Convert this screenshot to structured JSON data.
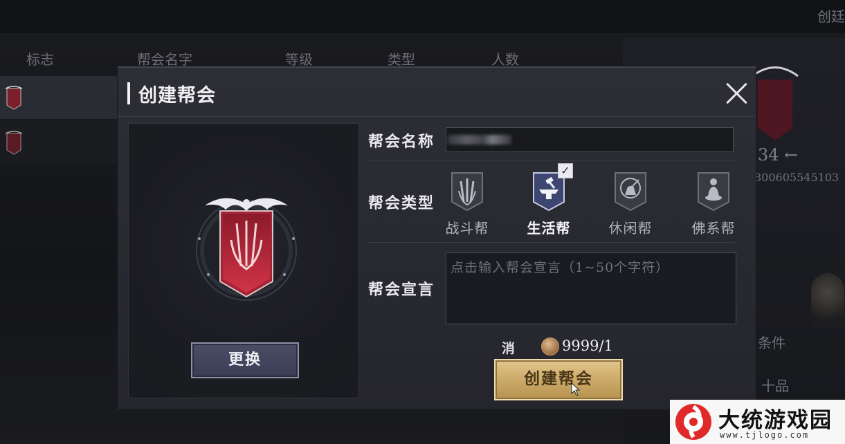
{
  "background": {
    "create_tab": "创廷",
    "table_headers": [
      "标志",
      "帮会名字",
      "等级",
      "类型",
      "人数"
    ],
    "right_panel": {
      "member_count": "34 ←",
      "guild_id": "800605545103",
      "condition_label": "条件",
      "level_label": "十品"
    }
  },
  "dialog": {
    "title": "创建帮会",
    "change_button": "更换",
    "name_label": "帮会名称",
    "name_value": "",
    "type_label": "帮会类型",
    "types": [
      {
        "label": "战斗帮",
        "selected": false,
        "icon": "swords-icon"
      },
      {
        "label": "生活帮",
        "selected": true,
        "icon": "anvil-icon"
      },
      {
        "label": "休闲帮",
        "selected": false,
        "icon": "fishing-icon"
      },
      {
        "label": "佛系帮",
        "selected": false,
        "icon": "meditation-icon"
      }
    ],
    "check_mark": "✓",
    "declaration_label": "帮会宣言",
    "declaration_placeholder": "点击输入帮会宣言（1~50个字符）",
    "cost_label": "消耗:",
    "cost_value": "9999/1",
    "create_button": "创建帮会"
  },
  "watermark": {
    "title": "大统游戏园",
    "url": "www.tjlogo.com"
  },
  "colors": {
    "dialog_bg": "#2b2c33",
    "gold_button": "#caa866",
    "change_button": "#454760",
    "banner_red": "#b4283a"
  }
}
